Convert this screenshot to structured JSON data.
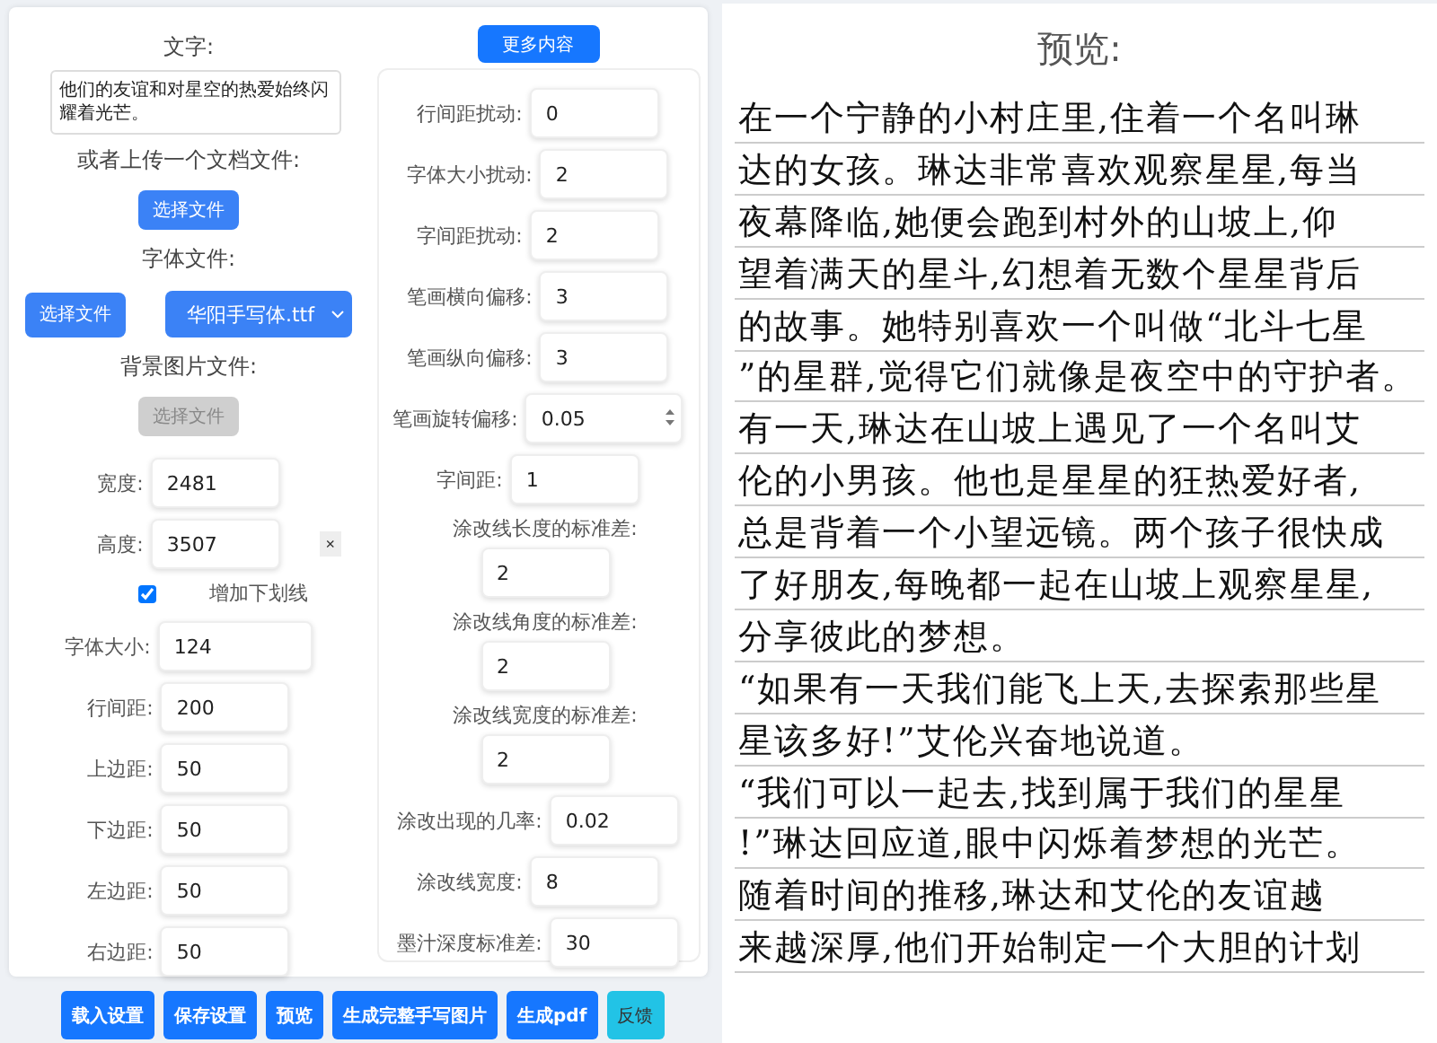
{
  "text_section": {
    "label": "文字:",
    "value": "他们的友谊和对星空的热爱始终闪耀着光芒。"
  },
  "upload_doc": {
    "label": "或者上传一个文档文件:",
    "button": "选择文件"
  },
  "font_file": {
    "label": "字体文件:",
    "button": "选择文件",
    "select": "华阳手写体.ttf"
  },
  "background_file": {
    "label": "背景图片文件:",
    "button": "选择文件",
    "disabled": true
  },
  "size_fields": [
    {
      "label": "宽度:",
      "value": "2481"
    },
    {
      "label": "高度:",
      "value": "3507"
    }
  ],
  "clear_button": "×",
  "underline": {
    "label": "增加下划线",
    "checked": true
  },
  "layout_fields": [
    {
      "label": "字体大小:",
      "value": "124"
    },
    {
      "label": "行间距:",
      "value": "200"
    },
    {
      "label": "上边距:",
      "value": "50"
    },
    {
      "label": "下边距:",
      "value": "50"
    },
    {
      "label": "左边距:",
      "value": "50"
    },
    {
      "label": "右边距:",
      "value": "50"
    }
  ],
  "more_button": "更多内容",
  "advanced_fields": [
    {
      "label": "行间距扰动:",
      "value": "0",
      "kind": "inline"
    },
    {
      "label": "字体大小扰动:",
      "value": "2",
      "kind": "inline"
    },
    {
      "label": "字间距扰动:",
      "value": "2",
      "kind": "inline"
    },
    {
      "label": "笔画横向偏移:",
      "value": "3",
      "kind": "inline"
    },
    {
      "label": "笔画纵向偏移:",
      "value": "3",
      "kind": "inline"
    },
    {
      "label": "笔画旋转偏移:",
      "value": "0.05",
      "kind": "spinner"
    },
    {
      "label": "字间距:",
      "value": "1",
      "kind": "inline"
    },
    {
      "label": "涂改线长度的标准差:",
      "value": "2",
      "kind": "stacked"
    },
    {
      "label": "涂改线角度的标准差:",
      "value": "2",
      "kind": "stacked"
    },
    {
      "label": "涂改线宽度的标准差:",
      "value": "2",
      "kind": "stacked"
    },
    {
      "label": "涂改出现的几率:",
      "value": "0.02",
      "kind": "inline"
    },
    {
      "label": "涂改线宽度:",
      "value": "8",
      "kind": "inline"
    },
    {
      "label": "墨汁深度标准差:",
      "value": "30",
      "kind": "inline"
    }
  ],
  "preview": {
    "title": "预览:",
    "lines": [
      "在一个宁静的小村庄里,住着一个名叫琳",
      "达的女孩。琳达非常喜欢观察星星,每当",
      "夜幕降临,她便会跑到村外的山坡上,仰",
      "望着满天的星斗,幻想着无数个星星背后",
      "的故事。她特别喜欢一个叫做“北斗七星",
      "”的星群,觉得它们就像是夜空中的守护者。",
      "有一天,琳达在山坡上遇见了一个名叫艾",
      "伦的小男孩。他也是星星的狂热爱好者,",
      "总是背着一个小望远镜。两个孩子很快成",
      "了好朋友,每晚都一起在山坡上观察星星,",
      "分享彼此的梦想。",
      "“如果有一天我们能飞上天,去探索那些星",
      "星该多好!”艾伦兴奋地说道。",
      "“我们可以一起去,找到属于我们的星星",
      "!”琳达回应道,眼中闪烁着梦想的光芒。",
      "随着时间的推移,琳达和艾伦的友谊越",
      "来越深厚,他们开始制定一个大胆的计划"
    ]
  },
  "actions": [
    {
      "label": "载入设置",
      "kind": "primary"
    },
    {
      "label": "保存设置",
      "kind": "primary"
    },
    {
      "label": "预览",
      "kind": "primary"
    },
    {
      "label": "生成完整手写图片",
      "kind": "primary"
    },
    {
      "label": "生成pdf",
      "kind": "primary"
    },
    {
      "label": "反馈",
      "kind": "info"
    }
  ]
}
